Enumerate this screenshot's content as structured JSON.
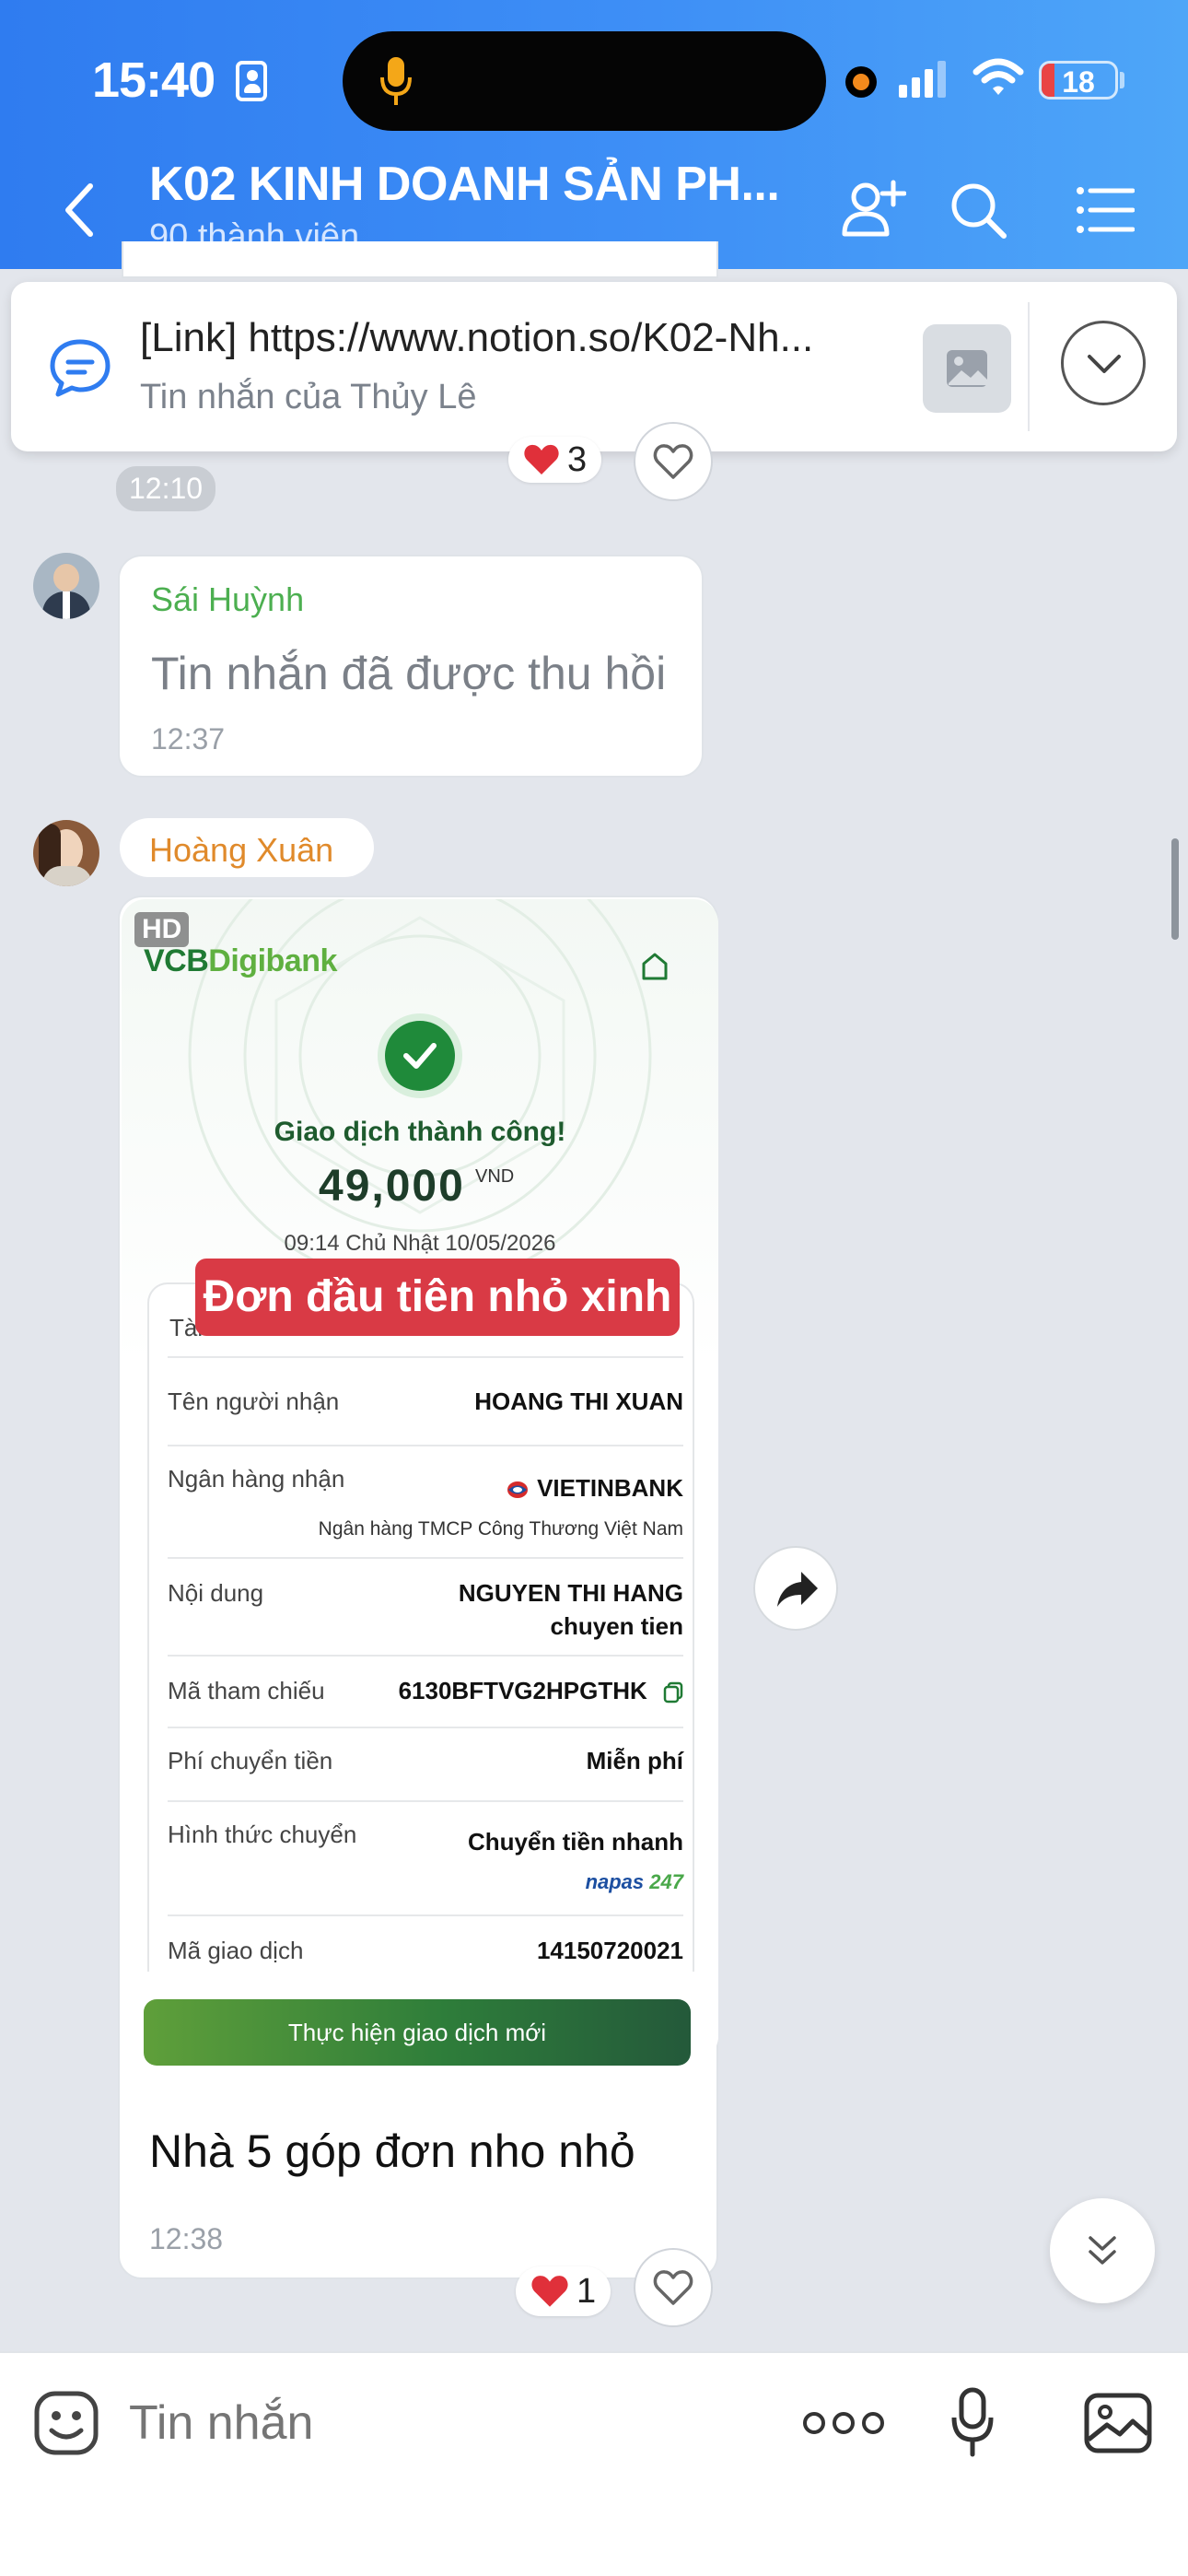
{
  "status_bar": {
    "time": "15:40",
    "battery": "18",
    "battery_fraction": 0.18
  },
  "header": {
    "title": "K02 KINH DOANH SẢN PH...",
    "subtitle": "90 thành viên"
  },
  "pinned": {
    "text": "[Link] https://www.notion.so/K02-Nh...",
    "subtext": "Tin nhắn của Thủy Lê"
  },
  "messages": {
    "first": {
      "time": "12:10",
      "reaction_count": "3"
    },
    "recalled": {
      "sender": "Sái Huỳnh",
      "text": "Tin nhắn đã được thu hồi",
      "time": "12:37"
    },
    "photo": {
      "sender": "Hoàng Xuân",
      "hd_badge": "HD",
      "caption": "Nhà 5 góp đơn nho nhỏ",
      "time": "12:38",
      "reaction_count": "1"
    }
  },
  "receipt": {
    "brand_vcb": "VCB",
    "brand_digibank": "Digibank",
    "status": "Giao dịch thành công!",
    "amount": "49,000",
    "currency": "VND",
    "datetime": "09:14 Chủ Nhật 10/05/2026",
    "overlay": "Đơn đầu tiên nhỏ xinh",
    "partial_label": "Tài",
    "rows": {
      "recipient": {
        "label": "Tên người nhận",
        "value": "HOANG THI XUAN"
      },
      "bank": {
        "label": "Ngân hàng nhận",
        "value": "VIETINBANK",
        "sub": "Ngân hàng TMCP Công Thương Việt Nam"
      },
      "content": {
        "label": "Nội dung",
        "value1": "NGUYEN THI HANG",
        "value2": "chuyen tien"
      },
      "reference": {
        "label": "Mã tham chiếu",
        "value": "6130BFTVG2HPGTHK"
      },
      "fee": {
        "label": "Phí chuyển tiền",
        "value": "Miễn phí"
      },
      "method": {
        "label": "Hình thức chuyển",
        "value": "Chuyển tiền nhanh",
        "brand_napas": "napas",
        "brand_247": "247"
      },
      "txid": {
        "label": "Mã giao dịch",
        "value": "14150720021"
      }
    },
    "new_tx_button": "Thực hiện giao dịch mới"
  },
  "input": {
    "placeholder": "Tin nhắn"
  },
  "colors": {
    "header_blue": "#2f7cf0",
    "vcb_green": "#1f7a34",
    "overlay_red": "#d93a45",
    "sender_green": "#4caf50",
    "sender_orange": "#e08a2b"
  }
}
